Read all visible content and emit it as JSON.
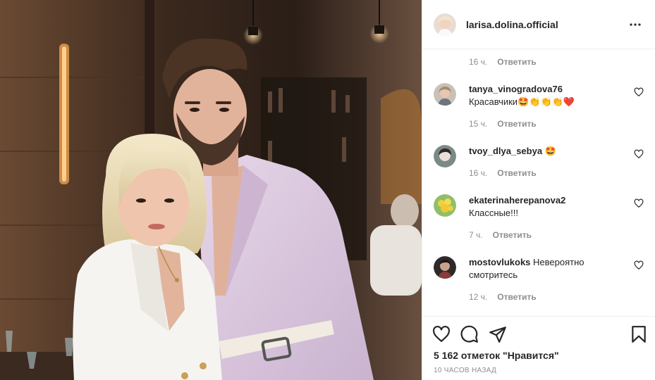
{
  "post": {
    "author": "larisa.dolina.official",
    "likes_text": "5 162 отметок \"Нравится\"",
    "posted_ago": "10 часов назад"
  },
  "top_meta": {
    "time": "16 ч.",
    "reply": "Ответить"
  },
  "comments": [
    {
      "user": "tanya_vinogradova76",
      "text": "Красавчики🤩👏👏👏❤️",
      "time": "15 ч.",
      "reply": "Ответить"
    },
    {
      "user": "tvoy_dlya_sebya",
      "text": "🤩",
      "time": "16 ч.",
      "reply": "Ответить"
    },
    {
      "user": "ekaterinaherepanova2",
      "text": "Классные!!!",
      "time": "7 ч.",
      "reply": "Ответить"
    },
    {
      "user": "mostovlukoks",
      "text": "Невероятно смотритесь",
      "time": "12 ч.",
      "reply": "Ответить"
    }
  ],
  "icons": {
    "more": "more-options-icon",
    "like": "heart-icon",
    "comment": "comment-icon",
    "share": "paper-plane-icon",
    "save": "bookmark-icon"
  },
  "colors": {
    "text": "#262626",
    "secondary": "#8e8e8e",
    "like_red": "#ed4956",
    "suit_lavender": "#d9c6dd"
  }
}
